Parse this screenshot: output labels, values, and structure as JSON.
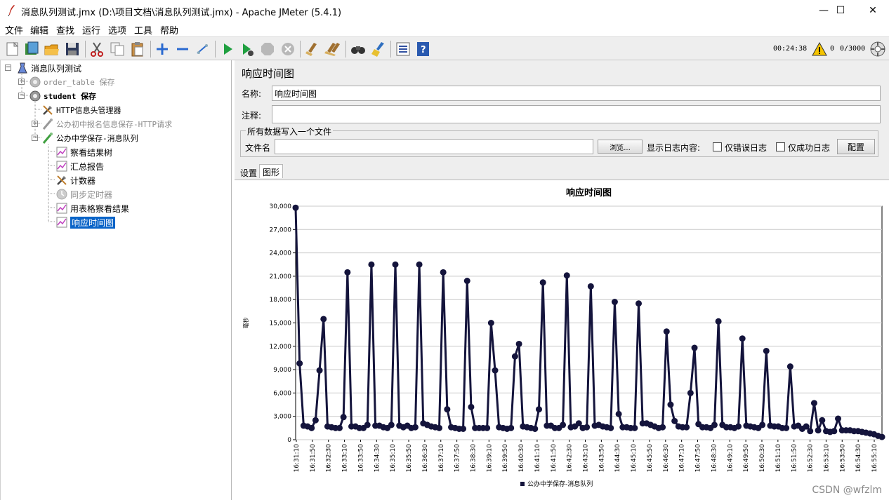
{
  "window": {
    "title": "消息队列测试.jmx (D:\\项目文档\\消息队列测试.jmx) - Apache JMeter (5.4.1)",
    "minimize": "—",
    "maximize": "☐",
    "close": "✕"
  },
  "menu": [
    "文件",
    "编辑",
    "查找",
    "运行",
    "选项",
    "工具",
    "帮助"
  ],
  "toolbar": {
    "icons": [
      "new-icon",
      "templates-icon",
      "open-icon",
      "save-icon",
      "cut-icon",
      "copy-icon",
      "paste-icon",
      "expand-icon",
      "collapse-icon",
      "toggle-icon",
      "start-icon",
      "start-no-pause-icon",
      "stop-icon",
      "shutdown-icon",
      "clear-icon",
      "clear-all-icon",
      "search-icon",
      "reset-search-icon",
      "function-helper-icon",
      "help-icon"
    ],
    "timer": "00:24:38",
    "errors": "0",
    "threads": "0/3000"
  },
  "tree": {
    "nodes": [
      {
        "label": "消息队列测试",
        "icon": "test-plan-icon"
      },
      {
        "label": "order_table 保存",
        "icon": "thread-group-icon",
        "disabled": true
      },
      {
        "label": "student 保存",
        "icon": "thread-group-icon"
      },
      {
        "label": "HTTP信息头管理器",
        "icon": "config-element-icon"
      },
      {
        "label": "公办初中报名信息保存-HTTP请求",
        "icon": "sampler-icon",
        "disabled": true
      },
      {
        "label": "公办中学保存-消息队列",
        "icon": "sampler-icon"
      },
      {
        "label": "察看结果树",
        "icon": "listener-icon"
      },
      {
        "label": "汇总报告",
        "icon": "listener-icon"
      },
      {
        "label": "计数器",
        "icon": "config-element-icon"
      },
      {
        "label": "同步定时器",
        "icon": "timer-icon",
        "disabled": true
      },
      {
        "label": "用表格察看结果",
        "icon": "listener-icon"
      },
      {
        "label": "响应时间图",
        "icon": "listener-icon",
        "selected": true
      }
    ]
  },
  "panel": {
    "title": "响应时间图",
    "name_label": "名称:",
    "name_value": "响应时间图",
    "comment_label": "注释:",
    "comment_value": "",
    "file_group_label": "所有数据写入一个文件",
    "filename_label": "文件名",
    "filename_value": "",
    "browse_button": "浏览...",
    "log_content_label": "显示日志内容:",
    "errors_only_label": "仅错误日志",
    "success_only_label": "仅成功日志",
    "configure_button": "配置",
    "tabs": [
      "设置",
      "图形"
    ]
  },
  "chart_data": {
    "type": "line",
    "title": "响应时间图",
    "ylabel": "毫秒",
    "xlabel": "",
    "ylim": [
      0,
      30000
    ],
    "yticks": [
      "0",
      "3,000",
      "6,000",
      "9,000",
      "12,000",
      "15,000",
      "18,000",
      "21,000",
      "24,000",
      "27,000",
      "30,000"
    ],
    "xticks": [
      "16:31:10",
      "16:31:50",
      "16:32:30",
      "16:33:10",
      "16:33:50",
      "16:34:30",
      "16:35:10",
      "16:35:50",
      "16:36:30",
      "16:37:10",
      "16:37:50",
      "16:38:30",
      "16:39:10",
      "16:39:50",
      "16:40:30",
      "16:41:10",
      "16:41:50",
      "16:42:30",
      "16:43:10",
      "16:43:50",
      "16:44:30",
      "16:45:10",
      "16:45:50",
      "16:46:30",
      "16:47:10",
      "16:47:50",
      "16:48:30",
      "16:49:10",
      "16:49:50",
      "16:50:30",
      "16:51:10",
      "16:51:50",
      "16:52:30",
      "16:53:10",
      "16:53:50",
      "16:54:30",
      "16:55:10"
    ],
    "grid": true,
    "legend_position": "bottom",
    "colors": {
      "series": "#14143c"
    },
    "series": [
      {
        "name": "公办中学保存-消息队列",
        "values": [
          29800,
          9800,
          1800,
          1700,
          1500,
          2500,
          8900,
          15500,
          1700,
          1600,
          1500,
          1500,
          2900,
          21500,
          1700,
          1700,
          1500,
          1500,
          1900,
          22500,
          1800,
          1800,
          1600,
          1500,
          1900,
          22500,
          1800,
          1600,
          1800,
          1500,
          1600,
          22500,
          2100,
          1900,
          1700,
          1600,
          1500,
          21500,
          3900,
          1600,
          1500,
          1400,
          1400,
          20400,
          4200,
          1500,
          1500,
          1500,
          1500,
          15000,
          8900,
          1600,
          1500,
          1400,
          1500,
          10700,
          12300,
          1700,
          1600,
          1500,
          1400,
          3900,
          20200,
          1800,
          1800,
          1500,
          1500,
          1900,
          21100,
          1600,
          1700,
          2100,
          1500,
          1600,
          19700,
          1800,
          1900,
          1700,
          1600,
          1500,
          17700,
          3300,
          1600,
          1600,
          1500,
          1500,
          17500,
          2100,
          2100,
          1900,
          1700,
          1500,
          1600,
          13900,
          4500,
          2400,
          1700,
          1600,
          1600,
          6000,
          11800,
          2000,
          1600,
          1600,
          1500,
          1900,
          15200,
          1900,
          1600,
          1600,
          1500,
          1700,
          13000,
          1800,
          1700,
          1600,
          1500,
          1900,
          11400,
          1800,
          1700,
          1700,
          1500,
          1500,
          9400,
          1700,
          1800,
          1400,
          1700,
          1100,
          4700,
          1200,
          2500,
          1100,
          1000,
          1100,
          2700,
          1200,
          1200,
          1200,
          1100,
          1100,
          1000,
          900,
          800,
          700,
          500,
          350
        ]
      }
    ]
  }
}
